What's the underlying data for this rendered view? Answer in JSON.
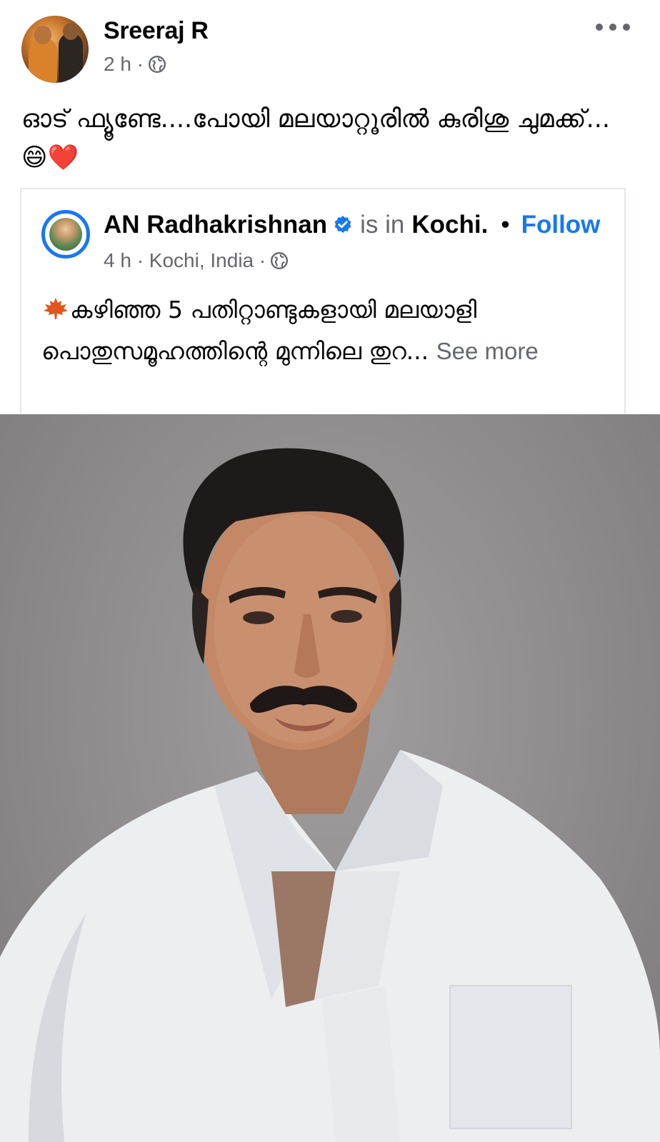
{
  "post": {
    "author": "Sreeraj R",
    "time": "2 h ·",
    "caption": "ഓട് ഫ്യൂണ്ടേ....പോയി മലയാറ്റൂരിൽ കുരിശു ചുമക്ക്...😄❤️"
  },
  "shared": {
    "name": "AN Radhakrishnan",
    "is_in": "is in",
    "place": "Kochi.",
    "separator": "•",
    "follow": "Follow",
    "time": "4 h · Kochi, India ·",
    "text": "കഴിഞ്ഞ 5 പതിറ്റാണ്ടുകളായി മലയാളി പൊതുസമൂഹത്തിന്റെ മുന്നിലെ തുറ...",
    "see_more": "See more"
  },
  "icons": {
    "globe": "globe-icon",
    "verified": "verified-badge-icon",
    "more": "more-options-icon",
    "leaf": "maple-leaf-icon"
  },
  "colors": {
    "accent": "#1877f2",
    "secondary_text": "#65676b",
    "divider": "#e4e6eb"
  }
}
